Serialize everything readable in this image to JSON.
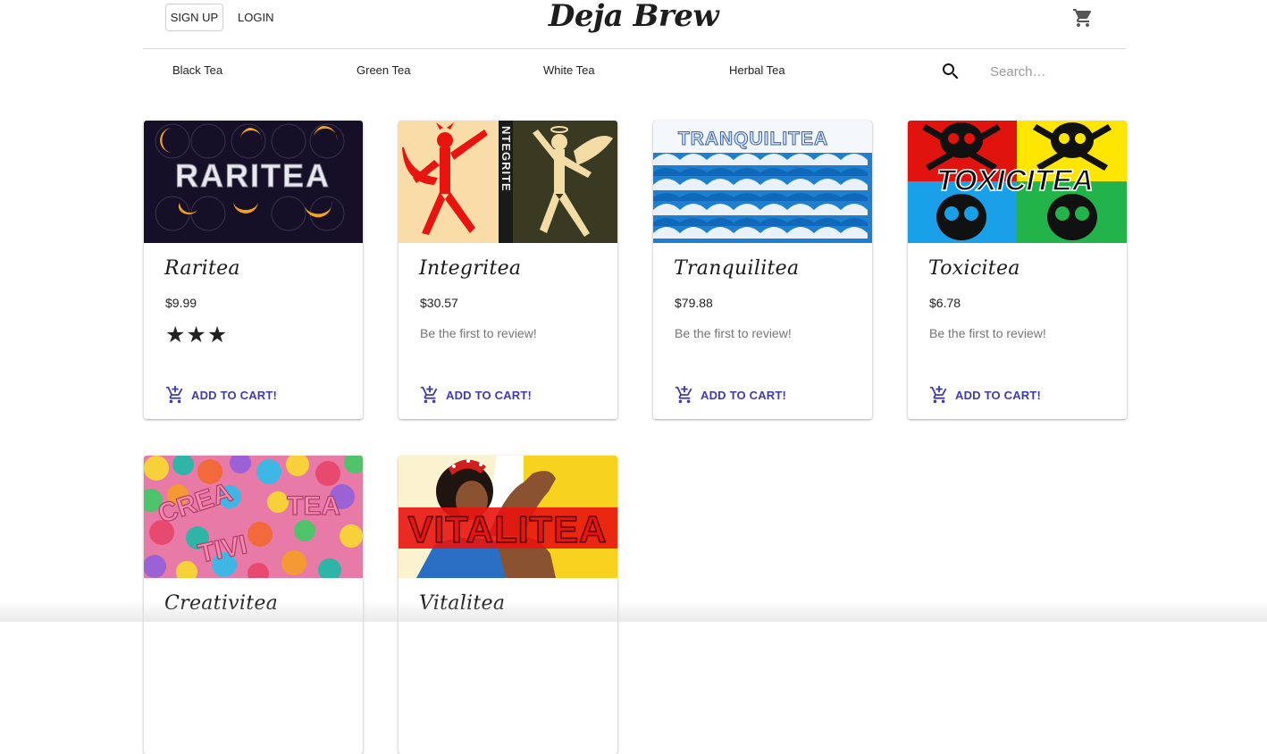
{
  "header": {
    "signup_label": "SIGN UP",
    "login_label": "LOGIN",
    "brand": "Deja Brew",
    "cart_icon": "shopping-cart-icon"
  },
  "nav": {
    "categories": [
      "Black Tea",
      "Green Tea",
      "White Tea",
      "Herbal Tea"
    ],
    "search_icon": "search-icon",
    "search_placeholder": "Search…"
  },
  "products": [
    {
      "name": "Raritea",
      "image_label": "RARITEA",
      "price": "$9.99",
      "rating_stars": 3,
      "stars_text": "★★★",
      "review_text": "",
      "add_label": "ADD TO CART!"
    },
    {
      "name": "Integritea",
      "image_label": "NTEGRITE",
      "price": "$30.57",
      "rating_stars": 0,
      "stars_text": "",
      "review_text": "Be the first to review!",
      "add_label": "ADD TO CART!"
    },
    {
      "name": "Tranquilitea",
      "image_label": "TRANQUILITEA",
      "price": "$79.88",
      "rating_stars": 0,
      "stars_text": "",
      "review_text": "Be the first to review!",
      "add_label": "ADD TO CART!"
    },
    {
      "name": "Toxicitea",
      "image_label": "TOXICITEA",
      "price": "$6.78",
      "rating_stars": 0,
      "stars_text": "",
      "review_text": "Be the first to review!",
      "add_label": "ADD TO CART!"
    },
    {
      "name": "Creativitea",
      "image_label_parts": [
        "CREA",
        "TIVI",
        "TEA"
      ],
      "price": "",
      "review_text": "",
      "add_label": ""
    },
    {
      "name": "Vitalitea",
      "image_label": "VITALITEA",
      "price": "",
      "review_text": "",
      "add_label": ""
    }
  ],
  "colors": {
    "accent": "#3f3bb0",
    "review_text": "#757575"
  }
}
